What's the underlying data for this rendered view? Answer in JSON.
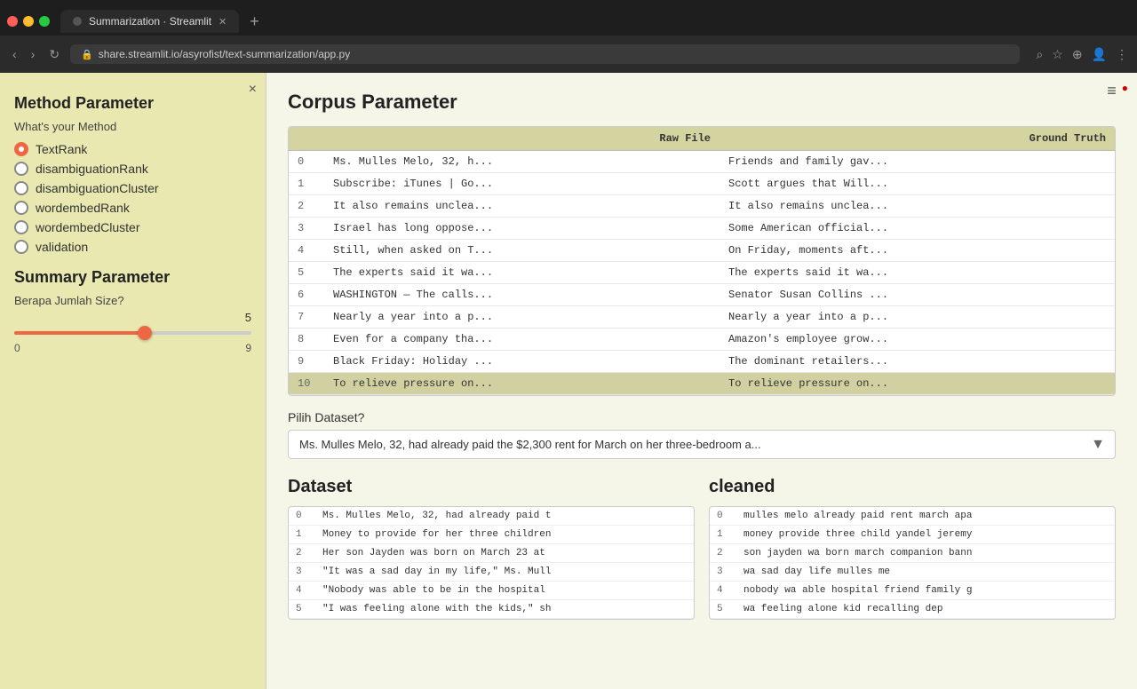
{
  "browser": {
    "tab_label": "Summarization · Streamlit",
    "url": "share.streamlit.io/asyrofist/text-summarization/app.py",
    "new_tab_icon": "+"
  },
  "sidebar": {
    "close_icon": "×",
    "method_section": {
      "title": "Method Parameter",
      "subtitle": "What's your Method",
      "options": [
        {
          "id": "TextRank",
          "label": "TextRank",
          "active": true
        },
        {
          "id": "disambiguationRank",
          "label": "disambiguationRank",
          "active": false
        },
        {
          "id": "disambiguationCluster",
          "label": "disambiguationCluster",
          "active": false
        },
        {
          "id": "wordembedRank",
          "label": "wordembedRank",
          "active": false
        },
        {
          "id": "wordembedCluster",
          "label": "wordembedCluster",
          "active": false
        },
        {
          "id": "validation",
          "label": "validation",
          "active": false
        }
      ]
    },
    "summary_section": {
      "title": "Summary Parameter",
      "slider_label": "Berapa Jumlah Size?",
      "slider_value": "5",
      "slider_min": "0",
      "slider_max": "9",
      "slider_percent": 55
    }
  },
  "main": {
    "corpus_title": "Corpus Parameter",
    "table": {
      "col_raw": "Raw File",
      "col_truth": "Ground Truth",
      "rows": [
        {
          "idx": 0,
          "raw": "Ms. Mulles Melo, 32, h...",
          "truth": "Friends and family gav..."
        },
        {
          "idx": 1,
          "raw": "Subscribe: iTunes | Go...",
          "truth": "Scott argues that Will..."
        },
        {
          "idx": 2,
          "raw": "It also remains unclea...",
          "truth": "It also remains unclea..."
        },
        {
          "idx": 3,
          "raw": "Israel has long oppose...",
          "truth": "Some American official..."
        },
        {
          "idx": 4,
          "raw": "Still, when asked on T...",
          "truth": "On Friday, moments aft..."
        },
        {
          "idx": 5,
          "raw": "The experts said it wa...",
          "truth": "The experts said it wa..."
        },
        {
          "idx": 6,
          "raw": "WASHINGTON — The calls...",
          "truth": "Senator Susan Collins ..."
        },
        {
          "idx": 7,
          "raw": "Nearly a year into a p...",
          "truth": "Nearly a year into a p..."
        },
        {
          "idx": 8,
          "raw": "Even for a company tha...",
          "truth": "Amazon's employee grow..."
        },
        {
          "idx": 9,
          "raw": "Black Friday: Holiday ...",
          "truth": "The dominant retailers..."
        },
        {
          "idx": 10,
          "raw": "To relieve pressure on...",
          "truth": "To relieve pressure on..."
        }
      ]
    },
    "pilih_label": "Pilih Dataset?",
    "dropdown_value": "Ms. Mulles Melo, 32, had already paid the $2,300 rent for March on her three-bedroom a...",
    "dataset_title": "Dataset",
    "cleaned_title": "cleaned",
    "dataset_rows": [
      {
        "idx": 0,
        "text": "Ms. Mulles Melo, 32, had already paid t"
      },
      {
        "idx": 1,
        "text": "Money to provide for her three children"
      },
      {
        "idx": 2,
        "text": "Her son Jayden was born on March 23 at"
      },
      {
        "idx": 3,
        "text": "\"It was a sad day in my life,\" Ms. Mull"
      },
      {
        "idx": 4,
        "text": "\"Nobody was able to be in the hospital"
      },
      {
        "idx": 5,
        "text": "\"I was feeling alone with the kids,\" sh"
      }
    ],
    "cleaned_rows": [
      {
        "idx": 0,
        "text": "mulles melo already paid rent march apa"
      },
      {
        "idx": 1,
        "text": "money provide three child yandel jeremy"
      },
      {
        "idx": 2,
        "text": "son jayden wa born march companion bann"
      },
      {
        "idx": 3,
        "text": "wa sad day life mulles me"
      },
      {
        "idx": 4,
        "text": "nobody wa able hospital friend family g"
      },
      {
        "idx": 5,
        "text": "wa feeling alone kid recalling dep"
      }
    ]
  },
  "icons": {
    "hamburger": "≡",
    "red_dot": "●",
    "close": "×",
    "arrow_down": "▼",
    "nav_back": "‹",
    "nav_fwd": "›",
    "nav_reload": "↻",
    "lock": "🔒"
  }
}
